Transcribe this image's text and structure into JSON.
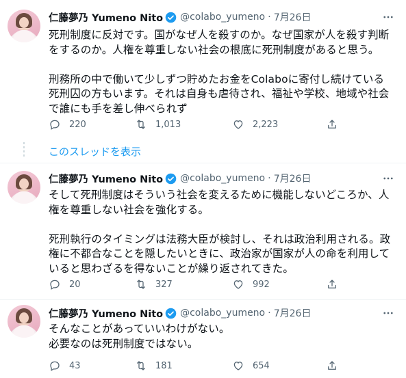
{
  "thread_link": "このスレッドを表示",
  "tweets": [
    {
      "name": "仁藤夢乃 Yumeno Nito",
      "handle": "@colabo_yumeno",
      "date": "7月26日",
      "text": "死刑制度に反対です。国がなぜ人を殺すのか。なぜ国家が人を殺す判断をするのか。人権を尊重しない社会の根底に死刑制度があると思う。\n\n刑務所の中で働いて少しずつ貯めたお金をColaboに寄付し続けている死刑囚の方もいます。それは自身も虐待され、福祉や学校、地域や社会で誰にも手を差し伸べられず",
      "replies": "220",
      "retweets": "1,013",
      "likes": "2,223"
    },
    {
      "name": "仁藤夢乃 Yumeno Nito",
      "handle": "@colabo_yumeno",
      "date": "7月26日",
      "text": "そして死刑制度はそういう社会を変えるために機能しないどころか、人権を尊重しない社会を強化する。\n\n死刑執行のタイミングは法務大臣が検討し、それは政治利用される。政権に不都合なことを隠したいときに、政治家が国家が人の命を利用していると思わざるを得ないことが繰り返されてきた。",
      "replies": "20",
      "retweets": "327",
      "likes": "992"
    },
    {
      "name": "仁藤夢乃 Yumeno Nito",
      "handle": "@colabo_yumeno",
      "date": "7月26日",
      "text": "そんなことがあっていいわけがない。\n必要なのは死刑制度ではない。",
      "replies": "43",
      "retweets": "181",
      "likes": "654"
    }
  ],
  "icons": {
    "verified": "verified-badge-icon",
    "more": "more-options-icon",
    "reply": "reply-icon",
    "retweet": "retweet-icon",
    "like": "heart-icon",
    "share": "share-icon"
  },
  "colors": {
    "accent": "#1d9bf0",
    "meta": "#536471",
    "text": "#0f1419"
  }
}
